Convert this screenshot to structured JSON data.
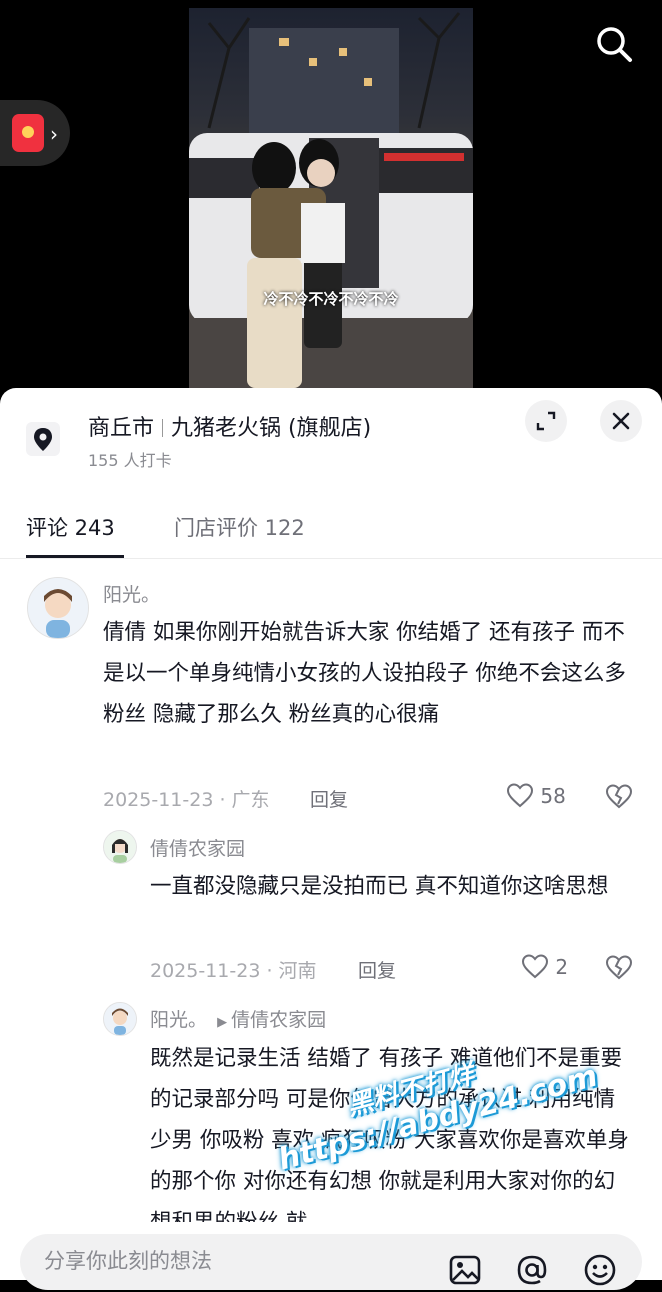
{
  "video": {
    "subtitle": "冷不冷不冷不冷不冷"
  },
  "location": {
    "city": "商丘市",
    "name": "九猪老火锅 (旗舰店)",
    "checkins": "155 人打卡"
  },
  "tabs": [
    {
      "label": "评论 243",
      "active": true
    },
    {
      "label": "门店评价 122",
      "active": false
    }
  ],
  "comments": [
    {
      "author": "阳光。",
      "text": "倩倩  如果你刚开始就告诉大家 你结婚了 还有孩子 而不是以一个单身纯情小女孩的人设拍段子 你绝不会这么多粉丝 隐藏了那么久 粉丝真的心很痛",
      "meta": "2025-11-23 · 广东",
      "reply_label": "回复",
      "likes": "58"
    },
    {
      "author": "倩倩农家园",
      "text": "一直都没隐藏只是没拍而已 真不知道你这啥思想",
      "meta": "2025-11-23 · 河南",
      "reply_label": "回复",
      "likes": "2"
    },
    {
      "author": "阳光。",
      "reply_to": "倩倩农家园",
      "text": "既然是记录生活 结婚了 有孩子  难道他们不是重要的记录部分吗  可是你何曾大方的承认过  利用纯情少男  你吸粉   喜欢 疯狂吸粉 大家喜欢你是喜欢单身的那个你 对你还有幻想 你就是利用大家对你的幻想和男的粉丝 就"
    }
  ],
  "watermark": {
    "line1": "黑料不打烊",
    "line2": "https://abdy24.com"
  },
  "composer": {
    "placeholder": "分享你此刻的想法"
  },
  "colors": {
    "text": "#161823",
    "secondary": "#8a8b91",
    "red_packet": "#f0313f"
  }
}
